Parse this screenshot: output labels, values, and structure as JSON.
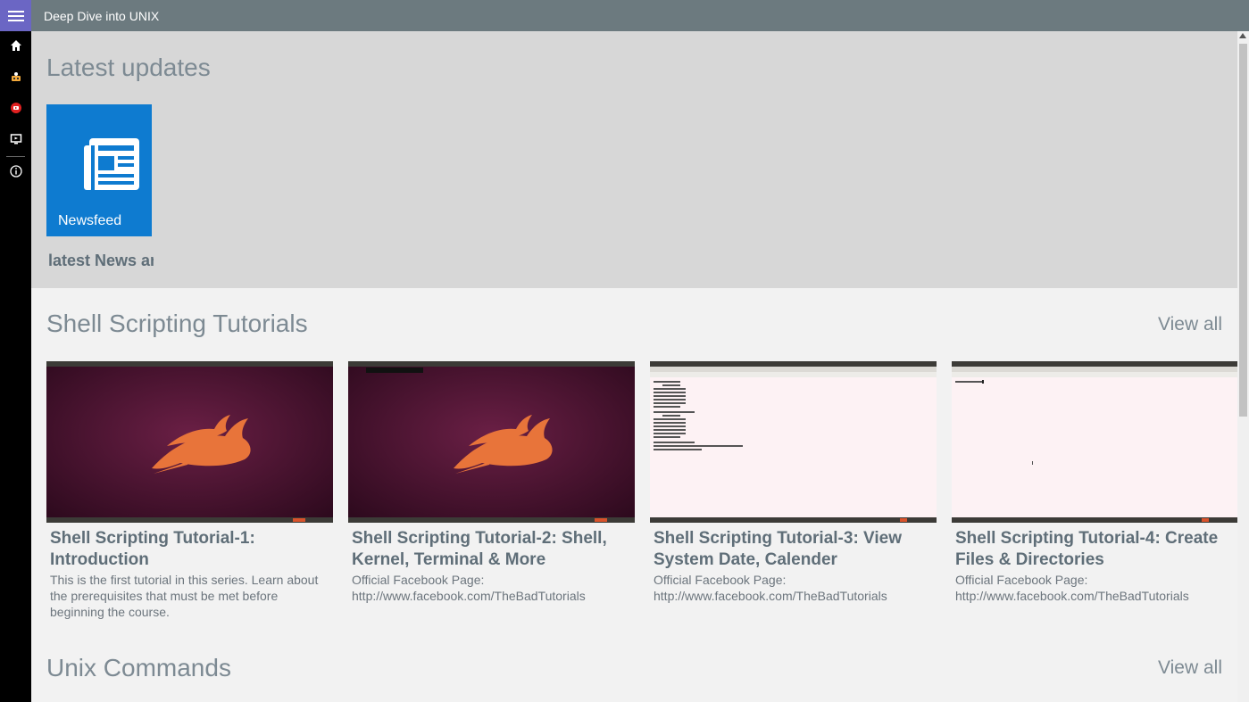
{
  "app": {
    "title": "Deep Dive into UNIX"
  },
  "sidebar": {
    "items": [
      {
        "name": "home",
        "icon": "home-icon"
      },
      {
        "name": "toy",
        "icon": "toy-icon"
      },
      {
        "name": "youtube",
        "icon": "youtube-icon",
        "color": "#e02020"
      },
      {
        "name": "video",
        "icon": "monitor-icon"
      },
      {
        "name": "about",
        "icon": "info-icon"
      }
    ]
  },
  "latest": {
    "heading": "Latest updates",
    "tile": {
      "label": "Newsfeed",
      "icon": "newspaper-icon",
      "color": "#0e7bd0"
    },
    "caption": "latest News and"
  },
  "shell": {
    "heading": "Shell Scripting Tutorials",
    "view_all": "View all",
    "cards": [
      {
        "title": "Shell Scripting Tutorial-1: Introduction",
        "desc": "This is the first tutorial in this series. Learn about the prerequisites that must be met before beginning the course.",
        "thumb": "ubuntu-desktop"
      },
      {
        "title": "Shell Scripting Tutorial-2: Shell, Kernel, Terminal & More",
        "desc": "Official Facebook Page: http://www.facebook.com/TheBadTutorials",
        "thumb": "ubuntu-desktop"
      },
      {
        "title": "Shell Scripting Tutorial-3: View System Date, Calender",
        "desc": "Official Facebook Page: http://www.facebook.com/TheBadTutorials",
        "thumb": "terminal-calendar"
      },
      {
        "title": "Shell Scripting Tutorial-4: Create Files & Directories",
        "desc": "Official Facebook Page: http://www.facebook.com/TheBadTutorials",
        "thumb": "terminal-empty"
      }
    ]
  },
  "unix": {
    "heading": "Unix Commands",
    "view_all": "View all"
  }
}
